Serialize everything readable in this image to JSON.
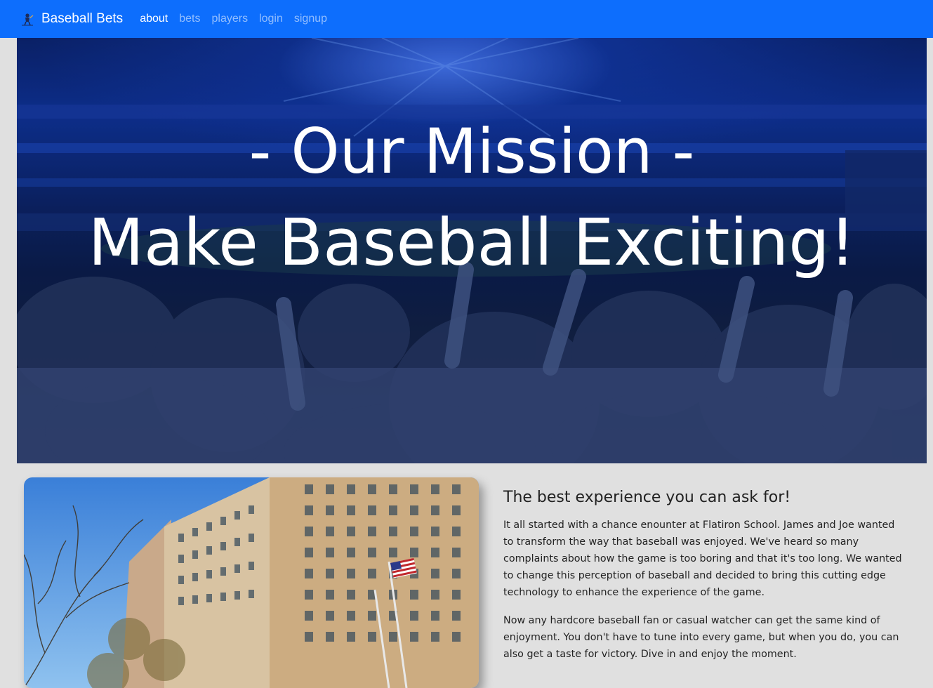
{
  "navbar": {
    "brand": "Baseball Bets",
    "links": [
      {
        "label": "about",
        "active": true
      },
      {
        "label": "bets",
        "active": false
      },
      {
        "label": "players",
        "active": false
      },
      {
        "label": "login",
        "active": false
      },
      {
        "label": "signup",
        "active": false
      }
    ],
    "color": "#0d6efd",
    "logo_icon": "baseball-player-icon"
  },
  "hero": {
    "line1": "- Our Mission -",
    "line2": "Make Baseball Exciting!"
  },
  "about": {
    "heading": "The best experience you can ask for!",
    "paragraphs": [
      "It all started with a chance enounter at Flatiron School. James and Joe wanted to transform the way that baseball was enjoyed. We've heard so many complaints about how the game is too boring and that it's too long. We wanted to change this perception of baseball and decided to bring this cutting edge technology to enhance the experience of the game.",
      "Now any hardcore baseball fan or casual watcher can get the same kind of enjoyment. You don't have to tune into every game, but when you do, you can also get a taste for victory. Dive in and enjoy the moment."
    ]
  }
}
